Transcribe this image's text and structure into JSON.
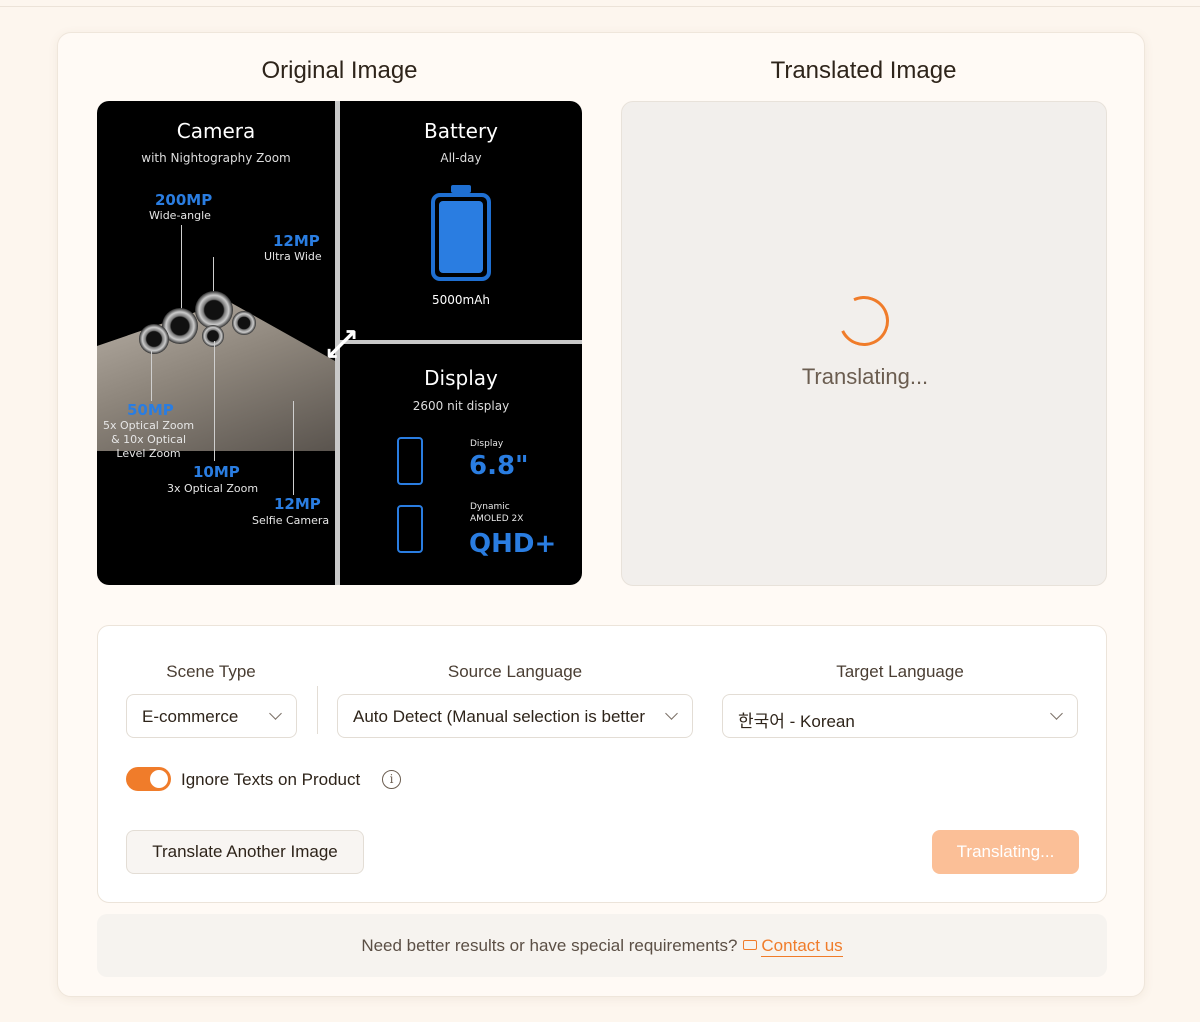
{
  "panels": {
    "original_title": "Original Image",
    "translated_title": "Translated Image",
    "translating_status": "Translating..."
  },
  "source_image": {
    "camera": {
      "title": "Camera",
      "subtitle": "with Nightography Zoom",
      "specs": [
        {
          "value": "200MP",
          "label": "Wide-angle"
        },
        {
          "value": "12MP",
          "label": "Ultra Wide"
        },
        {
          "value": "50MP",
          "label": "5x Optical Zoom\n& 10x Optical\nLevel Zoom"
        },
        {
          "value": "10MP",
          "label": "3x Optical Zoom"
        },
        {
          "value": "12MP",
          "label": "Selfie Camera"
        }
      ]
    },
    "battery": {
      "title": "Battery",
      "subtitle": "All-day",
      "capacity": "5000mAh"
    },
    "display": {
      "title": "Display",
      "subtitle": "2600 nit display",
      "size_label": "Display",
      "size_value": "6.8\"",
      "type_label": "Dynamic\nAMOLED 2X",
      "type_value": "QHD+"
    }
  },
  "controls": {
    "scene_type": {
      "label": "Scene Type",
      "value": "E-commerce"
    },
    "source_language": {
      "label": "Source Language",
      "value": "Auto Detect (Manual selection is better"
    },
    "target_language": {
      "label": "Target Language",
      "value": "한국어 - Korean"
    },
    "ignore_texts": {
      "label": "Ignore Texts on Product",
      "enabled": true
    },
    "translate_another_label": "Translate Another Image",
    "translating_button_label": "Translating..."
  },
  "footer": {
    "message": "Need better results or have special requirements?",
    "contact_label": "Contact us"
  },
  "colors": {
    "accent": "#f07c2a",
    "accent_disabled": "#fbbf97",
    "spec_blue": "#2a7de1"
  }
}
